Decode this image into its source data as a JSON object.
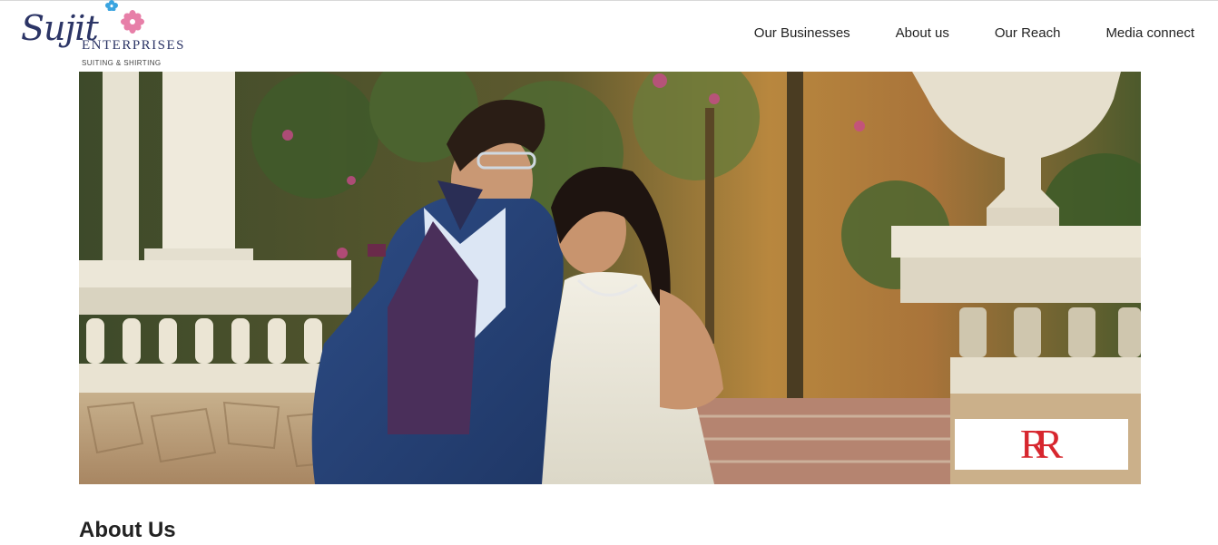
{
  "logo": {
    "name": "Sujit",
    "sub": "ENTERPRISES",
    "tagline": "SUITING & SHIRTING"
  },
  "nav": {
    "items": [
      {
        "label": "Our Businesses"
      },
      {
        "label": "About us"
      },
      {
        "label": "Our Reach"
      },
      {
        "label": "Media connect"
      }
    ]
  },
  "hero": {
    "brand_mark": "RR"
  },
  "about": {
    "title": "About Us"
  },
  "colors": {
    "logo_blue": "#2c3566",
    "brand_red": "#d7262e",
    "flower_pink": "#e77fa8",
    "flower_blue": "#3aa4e0"
  }
}
